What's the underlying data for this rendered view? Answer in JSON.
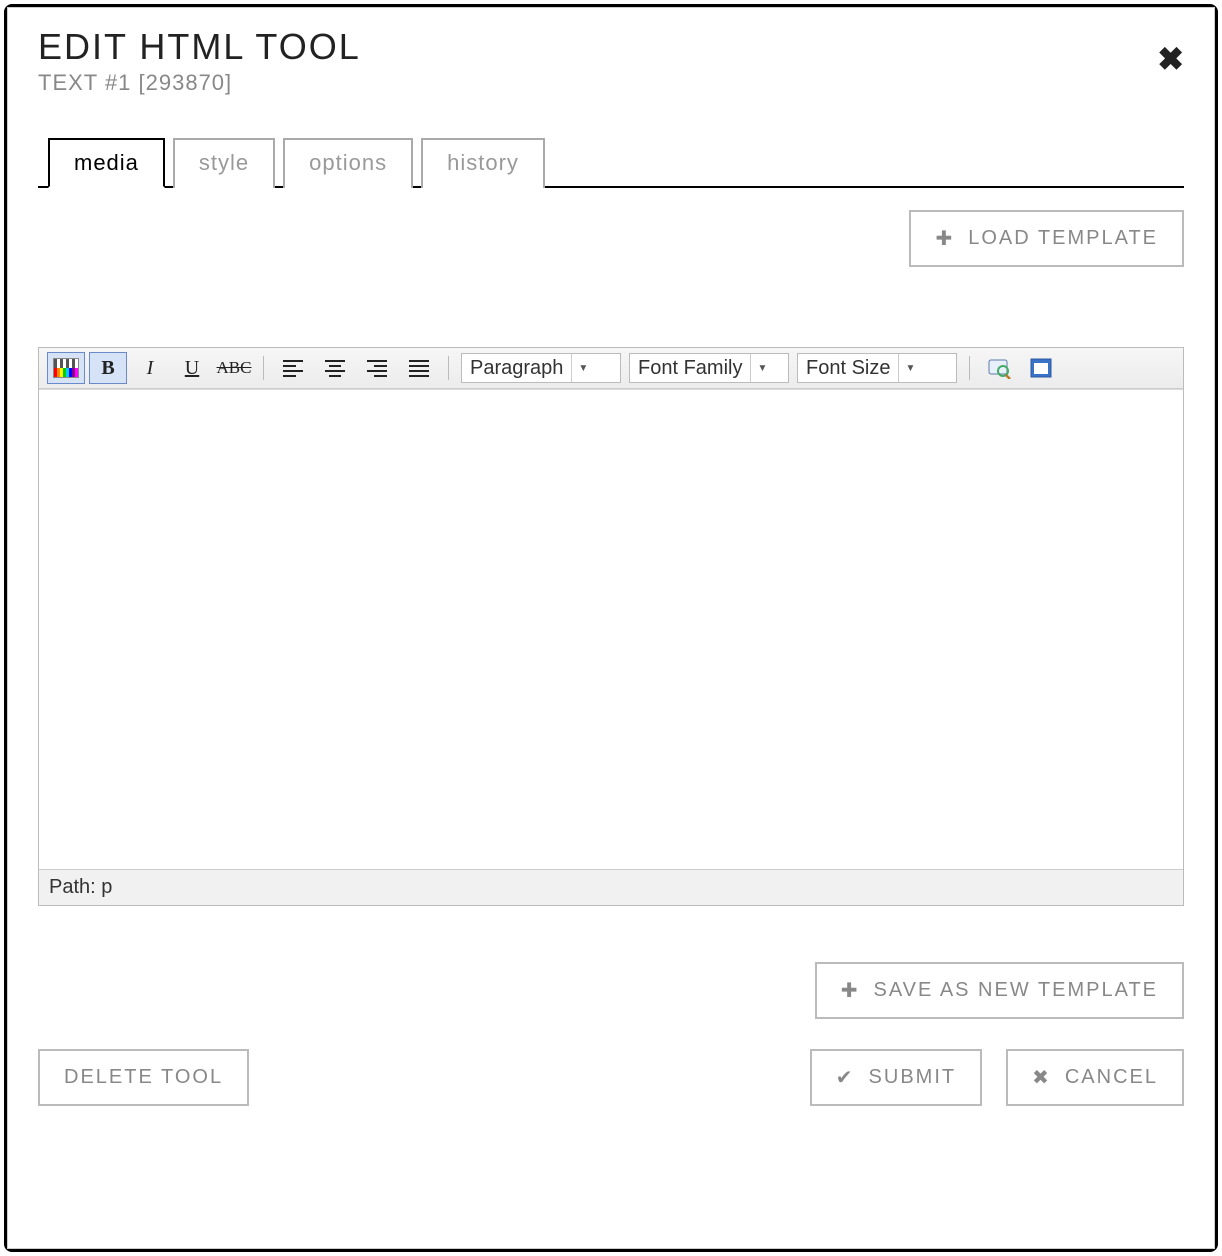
{
  "dialog": {
    "title": "EDIT HTML TOOL",
    "subtitle": "TEXT #1 [293870]"
  },
  "tabs": [
    {
      "label": "media",
      "active": true
    },
    {
      "label": "style",
      "active": false
    },
    {
      "label": "options",
      "active": false
    },
    {
      "label": "history",
      "active": false
    }
  ],
  "buttons": {
    "load_template": "LOAD TEMPLATE",
    "save_as_new_template": "SAVE AS NEW TEMPLATE",
    "delete_tool": "DELETE TOOL",
    "submit": "SUBMIT",
    "cancel": "CANCEL"
  },
  "editor": {
    "format_select": "Paragraph",
    "font_family_select": "Font Family",
    "font_size_select": "Font Size",
    "status_path_label": "Path:",
    "status_path_value": "p"
  }
}
